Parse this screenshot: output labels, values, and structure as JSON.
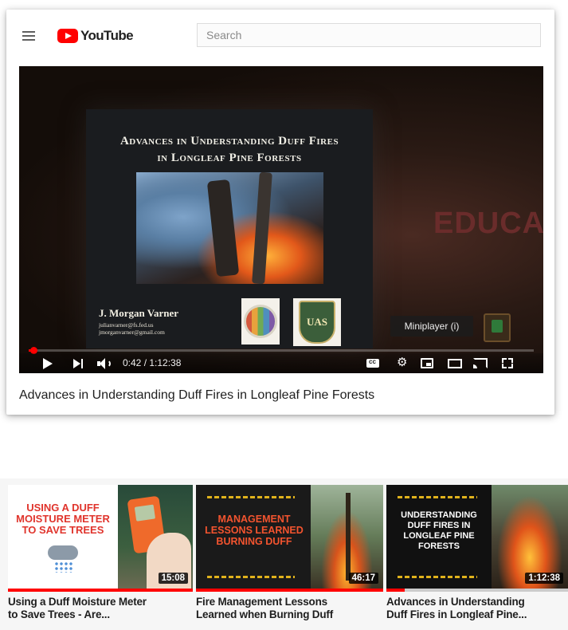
{
  "header": {
    "logo_text": "YouTube",
    "search_placeholder": "Search"
  },
  "player": {
    "slide": {
      "title_line1": "Advances in Understanding Duff Fires",
      "title_line2": "in Longleaf Pine Forests",
      "author": "J. Morgan Varner",
      "email1": "julianvarner@fs.fed.us",
      "email2": "jmorganvarner@gmail.com",
      "logo2_text": "UAS"
    },
    "background_text": "EDUCA",
    "tooltip": "Miniplayer (i)",
    "time": "0:42 / 1:12:38",
    "progress_fraction": 0.01,
    "accent_color": "#ff0000"
  },
  "video_title": "Advances in Understanding Duff Fires in Longleaf Pine Forests",
  "recommendations": [
    {
      "thumb_text": "Using a Duff Moisture Meter to Save Trees",
      "duration": "15:08",
      "title_line1": "Using a Duff Moisture Meter",
      "title_line2": "to Save Trees - Are...",
      "watched_fraction": 1.0
    },
    {
      "thumb_text": "Management Lessons Learned Burning Duff",
      "duration": "46:17",
      "title_line1": "Fire Management Lessons",
      "title_line2": "Learned when Burning Duff",
      "watched_fraction": 1.0
    },
    {
      "thumb_text": "Understanding Duff Fires in Longleaf Pine Forests",
      "duration": "1:12:38",
      "title_line1": "Advances in Understanding",
      "title_line2": "Duff Fires in Longleaf Pine...",
      "watched_fraction": 0.1
    }
  ]
}
